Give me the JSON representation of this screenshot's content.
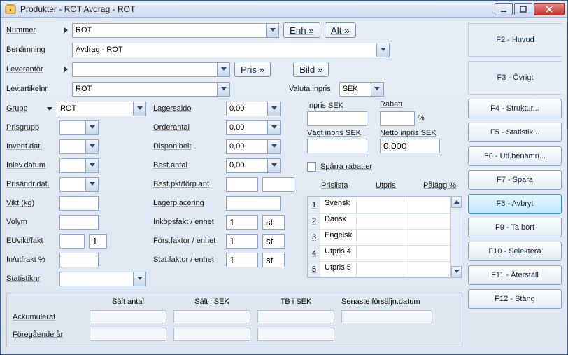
{
  "window": {
    "title": "Produkter - ROT Avdrag - ROT"
  },
  "header": {
    "nummer_label": "Nummer",
    "nummer_value": "ROT",
    "enh_btn": "Enh »",
    "alt_btn": "Alt »",
    "benamning_label": "Benämning",
    "benamning_value": "Avdrag - ROT",
    "leverantor_label": "Leverantör",
    "leverantor_value": "",
    "pris_btn": "Pris »",
    "bild_btn": "Bild »",
    "levartikelnr_label": "Lev.artikelnr",
    "levartikelnr_value": "ROT"
  },
  "left": {
    "grupp_label": "Grupp",
    "grupp_value": "ROT",
    "prisgrupp_label": "Prisgrupp",
    "prisgrupp_value": "",
    "inventdat_label": "Invent.dat.",
    "inventdat_value": "",
    "inlevdatum_label": "Inlev.datum",
    "inlevdatum_value": "",
    "prisandrdat_label": "Prisändr.dat.",
    "prisandrdat_value": "",
    "vikt_label": "Vikt (kg)",
    "vikt_value": "",
    "volym_label": "Volym",
    "volym_value": "",
    "euviktfakt_label": "EUvikt/fakt",
    "euviktfakt_value1": "",
    "euviktfakt_value2": "1",
    "inutfrakt_label": "In/utfrakt %",
    "inutfrakt_value": "",
    "statistiknr_label": "Statistiknr",
    "statistiknr_value": ""
  },
  "mid": {
    "lagersaldo_label": "Lagersaldo",
    "lagersaldo_value": "0,00",
    "orderantal_label": "Orderantal",
    "orderantal_value": "0,00",
    "disponibelt_label": "Disponibelt",
    "disponibelt_value": "0,00",
    "bestantal_label": "Best.antal",
    "bestantal_value": "0,00",
    "bestpkt_label": "Best.pkt/förp.ant",
    "bestpkt_value1": "",
    "bestpkt_value2": "",
    "lagerplacering_label": "Lagerplacering",
    "lagerplacering_value": "",
    "inkopsfakt_label": "Inköpsfakt / enhet",
    "inkopsfakt_value": "1",
    "inkopsfakt_unit": "st",
    "forsfaktor_label": "Förs.faktor / enhet",
    "forsfaktor_value": "1",
    "forsfaktor_unit": "st",
    "statfaktor_label": "Stat.faktor / enhet",
    "statfaktor_value": "1",
    "statfaktor_unit": "st"
  },
  "right": {
    "valuta_label": "Valuta inpris",
    "valuta_value": "SEK",
    "inpris_label": "Inpris SEK",
    "inpris_value": "",
    "rabatt_label": "Rabatt",
    "rabatt_value": "",
    "rabatt_unit": "%",
    "vagt_label": "Vägt inpris SEK",
    "vagt_value": "",
    "netto_label": "Netto inpris SEK",
    "netto_value": "0,000",
    "sparra_label": "Spärra rabatter",
    "col_prislista": "Prislista",
    "col_utpris": "Utpris",
    "col_palagg": "Pålägg %",
    "rows": [
      {
        "idx": "1",
        "name": "Svensk",
        "utpris": "",
        "palagg": ""
      },
      {
        "idx": "2",
        "name": "Dansk",
        "utpris": "",
        "palagg": ""
      },
      {
        "idx": "3",
        "name": "Engelsk",
        "utpris": "",
        "palagg": ""
      },
      {
        "idx": "4",
        "name": "Utpris 4",
        "utpris": "",
        "palagg": ""
      },
      {
        "idx": "5",
        "name": "Utpris 5",
        "utpris": "",
        "palagg": ""
      }
    ]
  },
  "bottom": {
    "salt_antal": "Sålt antal",
    "salt_sek": "Sålt i SEK",
    "tb_sek": "TB i SEK",
    "senaste": "Senaste försäljn.datum",
    "ackumulerat": "Ackumulerat",
    "foregaende": "Föregående år"
  },
  "side": {
    "f2": "F2 - Huvud",
    "f3": "F3 - Övrigt",
    "f4": "F4 - Struktur...",
    "f5": "F5 - Statistik...",
    "f6": "F6 - Utl.benämn...",
    "f7": "F7 - Spara",
    "f8": "F8 - Avbryt",
    "f9": "F9 - Ta bort",
    "f10": "F10 - Selektera",
    "f11": "F11 - Återställ",
    "f12": "F12 - Stäng"
  }
}
